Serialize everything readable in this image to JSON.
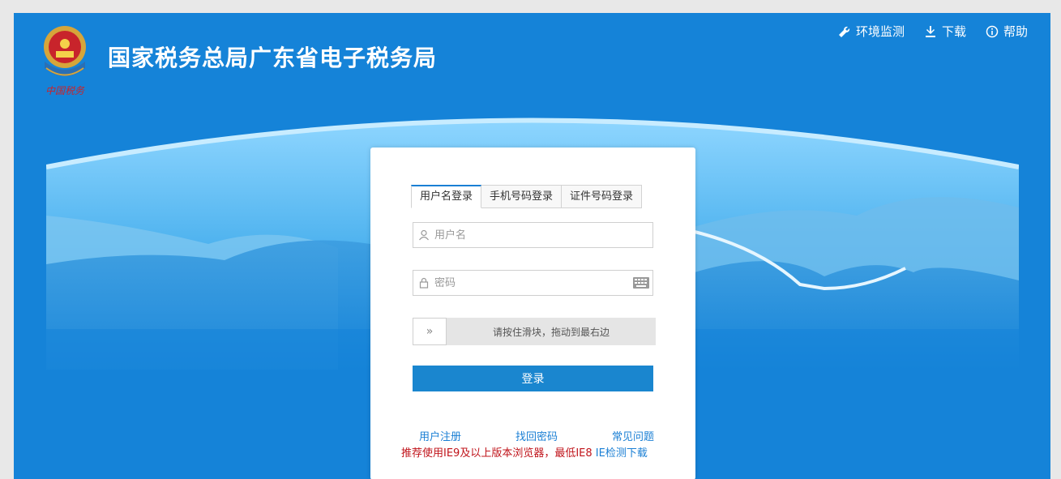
{
  "header": {
    "title": "国家税务总局广东省电子税务局",
    "emblem_text": "中国税务"
  },
  "topnav": {
    "env_check": "环境监测",
    "download": "下载",
    "help": "帮助"
  },
  "login": {
    "tabs": [
      "用户名登录",
      "手机号码登录",
      "证件号码登录"
    ],
    "active_tab": 0,
    "username_placeholder": "用户名",
    "password_placeholder": "密码",
    "slider_text": "请按住滑块，拖动到最右边",
    "slider_handle": "»",
    "submit": "登录",
    "links": [
      "用户注册",
      "找回密码",
      "常见问题"
    ],
    "notice": "推荐使用IE9及以上版本浏览器，最低IE8",
    "notice_link": "IE检测下载"
  },
  "colors": {
    "primary_blue": "#1583d8",
    "link_blue": "#1a7fd4",
    "notice_red": "#c0141b",
    "button_blue": "#1a86cf"
  }
}
